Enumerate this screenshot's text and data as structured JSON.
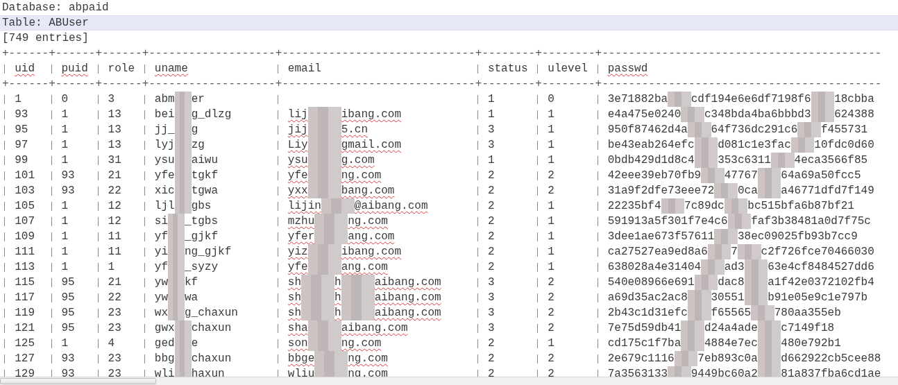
{
  "lines": [
    {
      "text": "Database: abpaid",
      "highlighted": false
    },
    {
      "text": "Table: ABUser",
      "highlighted": true
    },
    {
      "text": "[749 entries]",
      "highlighted": false
    }
  ],
  "table": {
    "border": "+------+------+------+-------------------+-----------------------------+--------+--------+------------------------------------------",
    "header_border": "+------+------+------+-------------------+-----------------------------+--------+--------+------------------------------------------",
    "columns": [
      {
        "label": "uid",
        "misspelled": true
      },
      {
        "label": "puid",
        "misspelled": true
      },
      {
        "label": "role",
        "misspelled": false
      },
      {
        "label": "uname",
        "misspelled": true
      },
      {
        "label": "email",
        "misspelled": false
      },
      {
        "label": "status",
        "misspelled": false
      },
      {
        "label": "ulevel",
        "misspelled": false
      },
      {
        "label": "passwd",
        "misspelled": true
      }
    ],
    "rows": [
      [
        [
          "1"
        ],
        [
          "0"
        ],
        [
          "3"
        ],
        [
          "abm",
          "er"
        ],
        [],
        [
          "1"
        ],
        [
          "0"
        ],
        [
          "3e71882ba",
          "cdf194e6e6df7198f6",
          "18cbba"
        ]
      ],
      [
        [
          "93"
        ],
        [
          "1"
        ],
        [
          "13"
        ],
        [
          "bei",
          "g_dlzg"
        ],
        [
          "lij",
          "ibang.com"
        ],
        [
          "1"
        ],
        [
          "1"
        ],
        [
          "e4a475e0240",
          "c348bda4ba6bbbd3",
          "624388"
        ]
      ],
      [
        [
          "95"
        ],
        [
          "1"
        ],
        [
          "13"
        ],
        [
          "jj_",
          "g"
        ],
        [
          "jij",
          "5.cn"
        ],
        [
          "3"
        ],
        [
          "1"
        ],
        [
          "950f87462d4a",
          "64f736dc291c6",
          "f455731"
        ]
      ],
      [
        [
          "97"
        ],
        [
          "1"
        ],
        [
          "13"
        ],
        [
          "lyj",
          "zg"
        ],
        [
          "Liy",
          "gmail.com"
        ],
        [
          "3"
        ],
        [
          "1"
        ],
        [
          "be43eab264efc",
          "d081c1e3fac",
          "10fdc0d60"
        ]
      ],
      [
        [
          "99"
        ],
        [
          "1"
        ],
        [
          "31"
        ],
        [
          "ysu",
          "aiwu"
        ],
        [
          "ysu",
          "g.com"
        ],
        [
          "1"
        ],
        [
          "1"
        ],
        [
          "0bdb429d1d8c4",
          "353c6311",
          "4eca3566f85"
        ]
      ],
      [
        [
          "101"
        ],
        [
          "93"
        ],
        [
          "21"
        ],
        [
          "yfe",
          "tgkf"
        ],
        [
          "yfe",
          "ng.com"
        ],
        [
          "2"
        ],
        [
          "2"
        ],
        [
          "42eee39eb70fb9",
          "47767",
          "64a69a50fcc5"
        ]
      ],
      [
        [
          "103"
        ],
        [
          "93"
        ],
        [
          "22"
        ],
        [
          "xic",
          "tgwa"
        ],
        [
          "yxx",
          "bang.com"
        ],
        [
          "2"
        ],
        [
          "2"
        ],
        [
          "31a9f2dfe73eee72",
          "0ca",
          "a46771dfd7f149"
        ]
      ],
      [
        [
          "105"
        ],
        [
          "1"
        ],
        [
          "12"
        ],
        [
          "ljl",
          "gbs"
        ],
        [
          "lijin",
          "@aibang.com"
        ],
        [
          "2"
        ],
        [
          "1"
        ],
        [
          "22235bf4",
          "7c89dc",
          "bc515bfa6b87bf21"
        ]
      ],
      [
        [
          "107"
        ],
        [
          "1"
        ],
        [
          "12"
        ],
        [
          "si",
          "_tgbs"
        ],
        [
          "mzhu",
          "ng.com"
        ],
        [
          "2"
        ],
        [
          "1"
        ],
        [
          "591913a5f301f7e4c6",
          "faf3b38481a0d7f75c"
        ]
      ],
      [
        [
          "109"
        ],
        [
          "1"
        ],
        [
          "11"
        ],
        [
          "yf",
          "_gjkf"
        ],
        [
          "yfer",
          "ang.com"
        ],
        [
          "2"
        ],
        [
          "1"
        ],
        [
          "3dee1ae673f57611",
          "38ec09025fb93b7cc9"
        ]
      ],
      [
        [
          "111"
        ],
        [
          "1"
        ],
        [
          "11"
        ],
        [
          "yi",
          "ng_gjkf"
        ],
        [
          "yiz",
          "ibang.com"
        ],
        [
          "2"
        ],
        [
          "1"
        ],
        [
          "ca27527ea9ed8a6",
          "7",
          "c2f726fce70466030"
        ]
      ],
      [
        [
          "113"
        ],
        [
          "1"
        ],
        [
          "1"
        ],
        [
          "yf",
          "_syzy"
        ],
        [
          "yfe",
          "ang.com"
        ],
        [
          "2"
        ],
        [
          "1"
        ],
        [
          "638028a4e31404",
          "ad3",
          "63e4cf8484527dd6"
        ]
      ],
      [
        [
          "115"
        ],
        [
          "95"
        ],
        [
          "21"
        ],
        [
          "yw",
          "kf"
        ],
        [
          "sh",
          "h",
          "aibang.com"
        ],
        [
          "3"
        ],
        [
          "2"
        ],
        [
          "540e08966e691",
          "dac8",
          "a1f42e0372102fb4"
        ]
      ],
      [
        [
          "117"
        ],
        [
          "95"
        ],
        [
          "22"
        ],
        [
          "yw",
          "wa"
        ],
        [
          "sh",
          "h",
          "aibang.com"
        ],
        [
          "3"
        ],
        [
          "2"
        ],
        [
          "a69d35ac2ac8",
          "30551",
          "b91e05e9c1e797b"
        ]
      ],
      [
        [
          "119"
        ],
        [
          "95"
        ],
        [
          "23"
        ],
        [
          "wx",
          "g_chaxun"
        ],
        [
          "sh",
          "h",
          "aibang.com"
        ],
        [
          "3"
        ],
        [
          "2"
        ],
        [
          "2b43c1d31efc",
          "f65565",
          "780aa355eb"
        ]
      ],
      [
        [
          "121"
        ],
        [
          "95"
        ],
        [
          "23"
        ],
        [
          "gwx",
          "chaxun"
        ],
        [
          "sha",
          "aibang.com"
        ],
        [
          "3"
        ],
        [
          "2"
        ],
        [
          "7e75d59db41",
          "d24a4ade",
          "c7149f18"
        ]
      ],
      [
        [
          "125"
        ],
        [
          "1"
        ],
        [
          "4"
        ],
        [
          "ged",
          "e"
        ],
        [
          "son",
          "ng.com"
        ],
        [
          "2"
        ],
        [
          "1"
        ],
        [
          "cd175c1f7ba",
          "4884e7ec",
          "480e792b1"
        ]
      ],
      [
        [
          "127"
        ],
        [
          "93"
        ],
        [
          "23"
        ],
        [
          "bbg",
          "chaxun"
        ],
        [
          "bbge",
          "ng.com"
        ],
        [
          "2"
        ],
        [
          "2"
        ],
        [
          "2e679c1116",
          "7eb893c0a",
          "d662922cb5cee88"
        ]
      ],
      [
        [
          "129"
        ],
        [
          "93"
        ],
        [
          "23"
        ],
        [
          "wli",
          "haxun"
        ],
        [
          "wliu",
          "ng.com"
        ],
        [
          "2"
        ],
        [
          "2"
        ],
        [
          "7a3563133",
          "9449bc60a2",
          "81a837fba6cd1ae"
        ]
      ]
    ]
  }
}
